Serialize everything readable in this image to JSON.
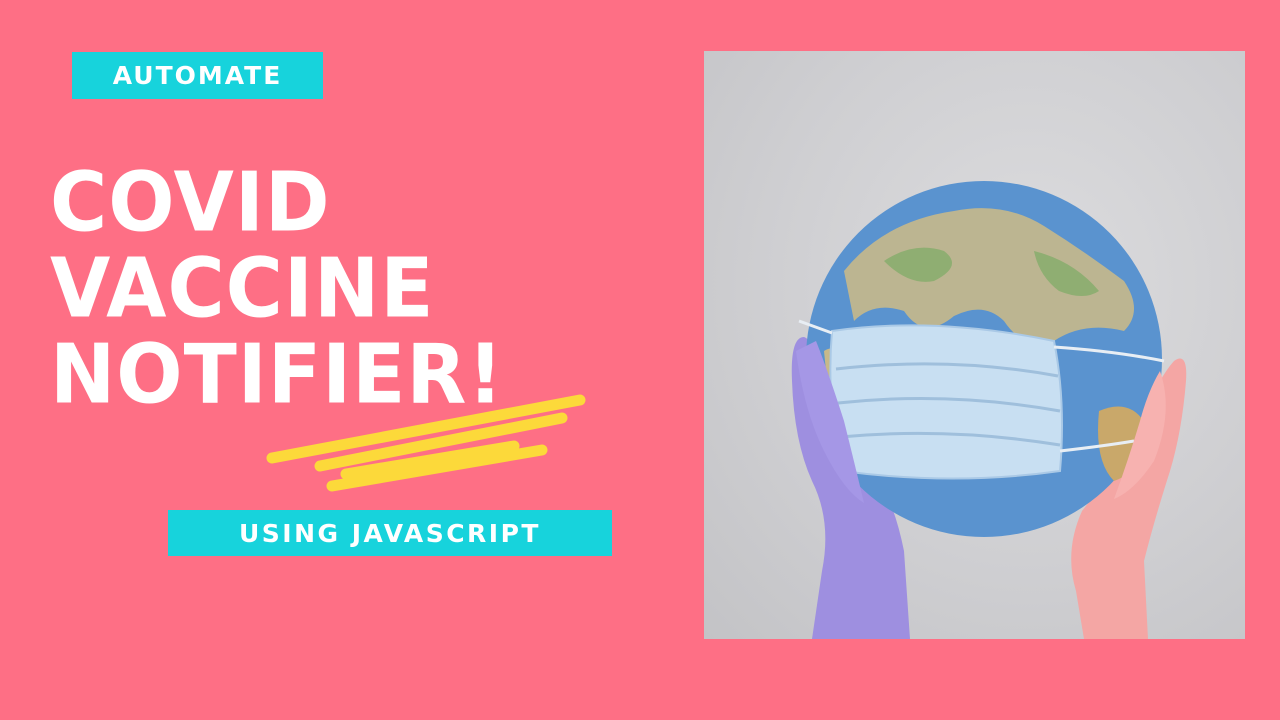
{
  "badge_top": "AUTOMATE",
  "headline": {
    "line1": "COVID",
    "line2": "VACCINE",
    "line3": "NOTIFIER!"
  },
  "badge_bottom": "USING JAVASCRIPT",
  "colors": {
    "background": "#fe6f85",
    "badge": "#17d3dc",
    "text": "#ffffff",
    "underline": "#fcd93a"
  },
  "photo": {
    "icon": "globe-with-mask-photo"
  }
}
